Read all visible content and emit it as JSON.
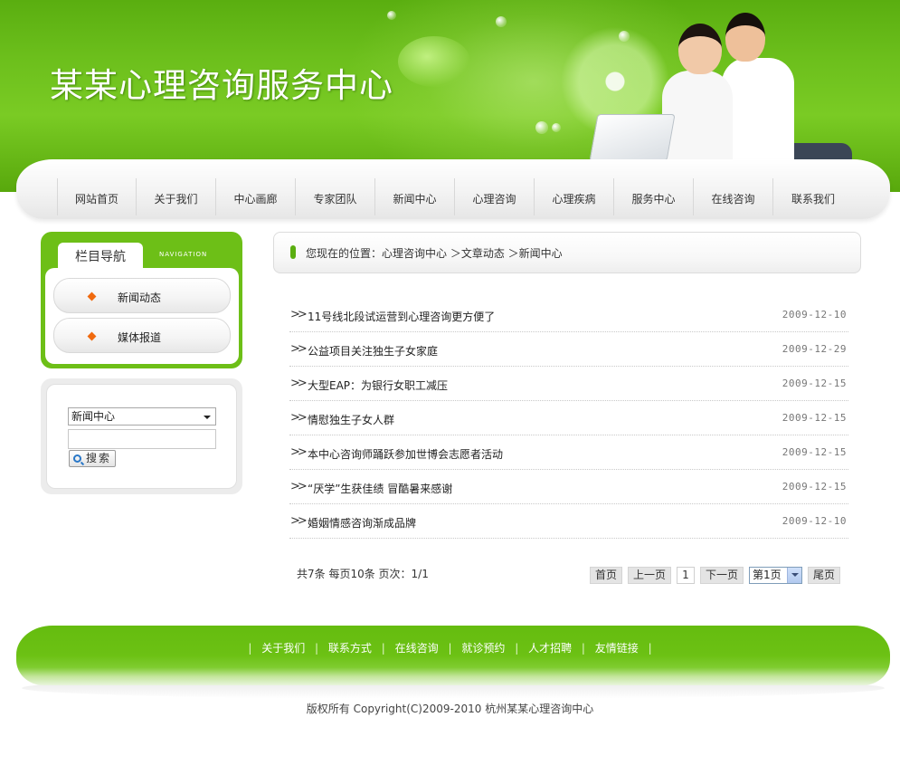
{
  "header": {
    "site_title": "某某心理咨询服务中心"
  },
  "nav": {
    "items": [
      "网站首页",
      "关于我们",
      "中心画廊",
      "专家团队",
      "新闻中心",
      "心理咨询",
      "心理疾病",
      "服务中心",
      "在线咨询",
      "联系我们"
    ]
  },
  "sidebar": {
    "tab_label": "栏目导航",
    "tab_label_en": "NAVIGATION",
    "items": [
      "新闻动态",
      "媒体报道"
    ]
  },
  "search": {
    "select_value": "新闻中心",
    "input_value": "",
    "button_label": "搜索"
  },
  "breadcrumb": {
    "text": "您现在的位置：心理咨询中心 ＞文章动态 ＞新闻中心"
  },
  "news": [
    {
      "title": "11号线北段试运营到心理咨询更方便了",
      "date": "2009-12-10"
    },
    {
      "title": "公益项目关注独生子女家庭",
      "date": "2009-12-29"
    },
    {
      "title": "大型EAP：为银行女职工减压",
      "date": "2009-12-15"
    },
    {
      "title": "情慰独生子女人群",
      "date": "2009-12-15"
    },
    {
      "title": "本中心咨询师踊跃参加世博会志愿者活动",
      "date": "2009-12-15"
    },
    {
      "title": "“厌学”生获佳绩 冒酷暑来感谢",
      "date": "2009-12-15"
    },
    {
      "title": "婚姻情感咨询渐成品牌",
      "date": "2009-12-10"
    }
  ],
  "pager": {
    "info": "共7条  每页10条  页次：1/1",
    "first": "首页",
    "prev": "上一页",
    "current": "1",
    "next": "下一页",
    "select_value": "第1页",
    "last": "尾页"
  },
  "footer": {
    "links": [
      "关于我们",
      "联系方式",
      "在线咨询",
      "就诊预约",
      "人才招聘",
      "友情链接"
    ],
    "separator": "|",
    "copyright": "版权所有  Copyright(C)2009-2010 杭州某某心理咨询中心"
  },
  "colors": {
    "brand_green": "#6dbf17",
    "accent_orange": "#f06a0f"
  }
}
